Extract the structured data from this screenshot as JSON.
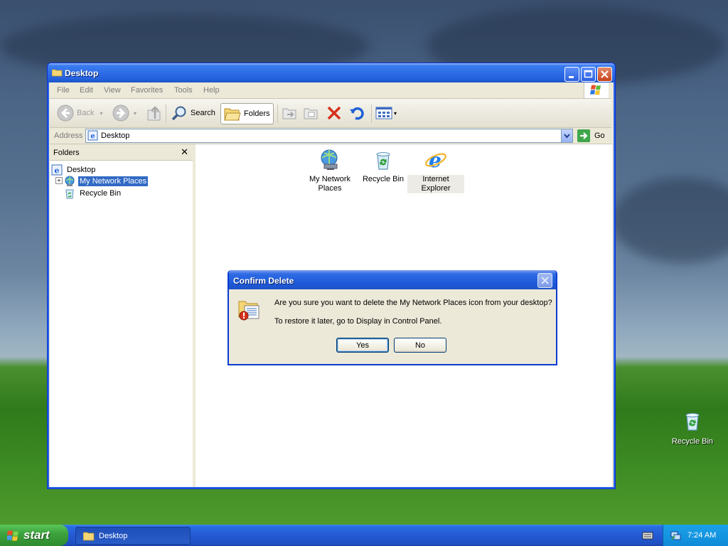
{
  "window": {
    "title": "Desktop",
    "menu": [
      "File",
      "Edit",
      "View",
      "Favorites",
      "Tools",
      "Help"
    ],
    "toolbar": {
      "back": "Back",
      "search": "Search",
      "folders": "Folders"
    },
    "address": {
      "label": "Address",
      "value": "Desktop",
      "go": "Go"
    },
    "folders_pane": {
      "title": "Folders",
      "close": "✕",
      "tree": {
        "root": "Desktop",
        "items": [
          "My Network Places",
          "Recycle Bin"
        ],
        "expander": "+"
      }
    },
    "content": {
      "items": [
        {
          "line1": "My Network",
          "line2": "Places"
        },
        {
          "line1": "Recycle Bin",
          "line2": ""
        },
        {
          "line1": "Internet",
          "line2": "Explorer"
        }
      ]
    }
  },
  "dialog": {
    "title": "Confirm Delete",
    "message": "Are you sure you want to delete the My Network Places icon from your desktop?",
    "hint": "To restore it later, go to Display in Control Panel.",
    "yes": "Yes",
    "no": "No"
  },
  "desktop": {
    "icons": [
      {
        "label": "Recycle Bin"
      }
    ]
  },
  "taskbar": {
    "start": "start",
    "task": "Desktop",
    "clock": "7:24 AM"
  },
  "colors": {
    "titlebar_blue": "#2461de",
    "selection": "#316ac5",
    "taskbar_blue": "#2459d4",
    "start_green": "#3ea33e",
    "tray_blue": "#0f8ad8",
    "delete_red": "#d6301c"
  }
}
